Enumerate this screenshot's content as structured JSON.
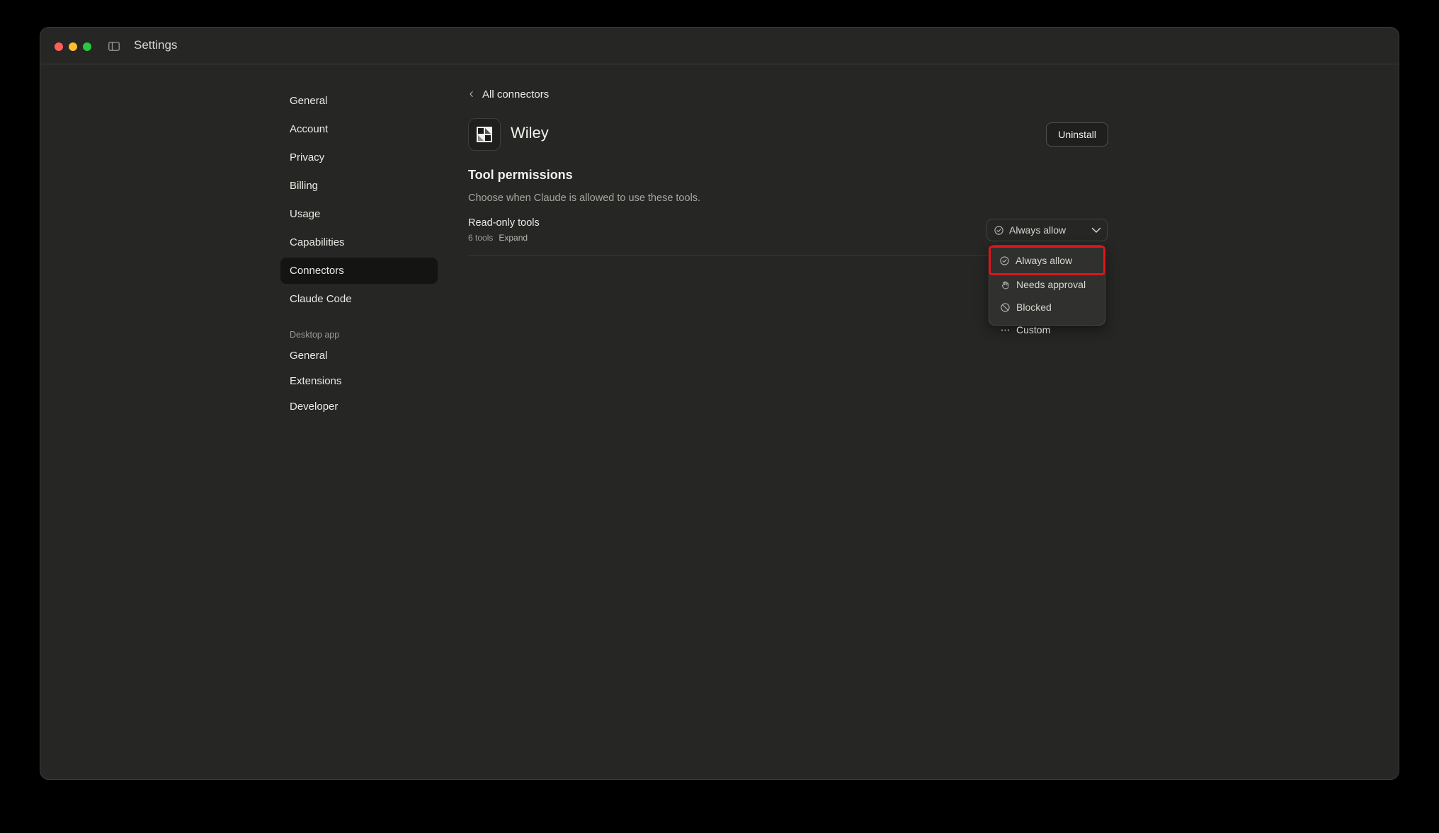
{
  "window": {
    "title": "Settings"
  },
  "nav": {
    "items": [
      {
        "label": "General"
      },
      {
        "label": "Account"
      },
      {
        "label": "Privacy"
      },
      {
        "label": "Billing"
      },
      {
        "label": "Usage"
      },
      {
        "label": "Capabilities"
      },
      {
        "label": "Connectors",
        "active": true
      },
      {
        "label": "Claude Code"
      }
    ],
    "section_label": "Desktop app",
    "desktop_items": [
      {
        "label": "General"
      },
      {
        "label": "Extensions"
      },
      {
        "label": "Developer"
      }
    ]
  },
  "connector": {
    "back_label": "All connectors",
    "name": "Wiley",
    "uninstall_label": "Uninstall"
  },
  "permissions": {
    "title": "Tool permissions",
    "description": "Choose when Claude is allowed to use these tools.",
    "group": {
      "title": "Read-only tools",
      "count": "6 tools",
      "expand_label": "Expand",
      "selected": "Always allow",
      "selected_icon": "check-circle-icon"
    },
    "options": [
      {
        "label": "Always allow",
        "icon": "check-circle-icon"
      },
      {
        "label": "Needs approval",
        "icon": "hand-icon"
      },
      {
        "label": "Blocked",
        "icon": "blocked-icon"
      },
      {
        "label": "Custom",
        "icon": "ellipsis-icon"
      }
    ]
  },
  "colors": {
    "background": "#262624",
    "active_nav": "#141413",
    "highlight_outline": "#e0141b"
  }
}
